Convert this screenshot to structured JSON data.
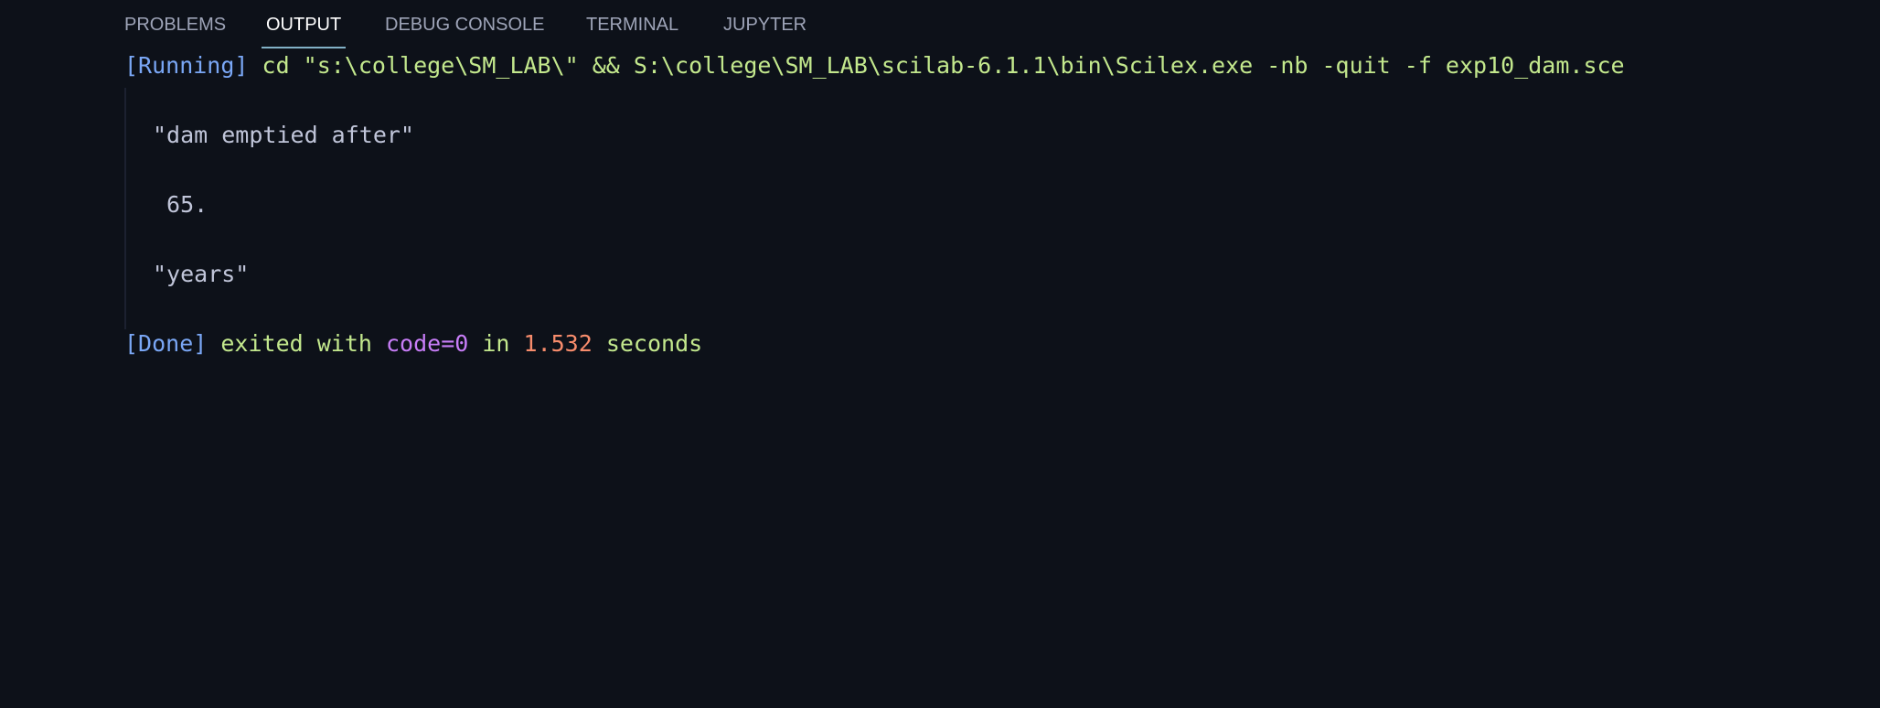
{
  "panel": {
    "tabs": [
      {
        "label": "PROBLEMS",
        "active": false
      },
      {
        "label": "OUTPUT",
        "active": true
      },
      {
        "label": "DEBUG CONSOLE",
        "active": false
      },
      {
        "label": "TERMINAL",
        "active": false
      },
      {
        "label": "JUPYTER",
        "active": false
      }
    ],
    "active_tab_underline_color": "#82b1c7"
  },
  "output": {
    "running_tag": "[Running]",
    "command": " cd \"s:\\college\\SM_LAB\\\" && S:\\college\\SM_LAB\\scilab-6.1.1\\bin\\Scilex.exe -nb -quit -f exp10_dam.sce",
    "lines": [
      "\"dam emptied after\"",
      " 65.",
      "\"years\""
    ],
    "done": {
      "tag": "[Done]",
      "text1": " exited with ",
      "code": "code=0",
      "text2": " in ",
      "duration": "1.532",
      "text3": " seconds"
    }
  },
  "colors": {
    "background": "#0d1119",
    "tag": "#7aa7f5",
    "command": "#c3e88d",
    "program_output": "#c0c5d9",
    "exit_code": "#c77df7",
    "duration": "#f78c6c"
  }
}
